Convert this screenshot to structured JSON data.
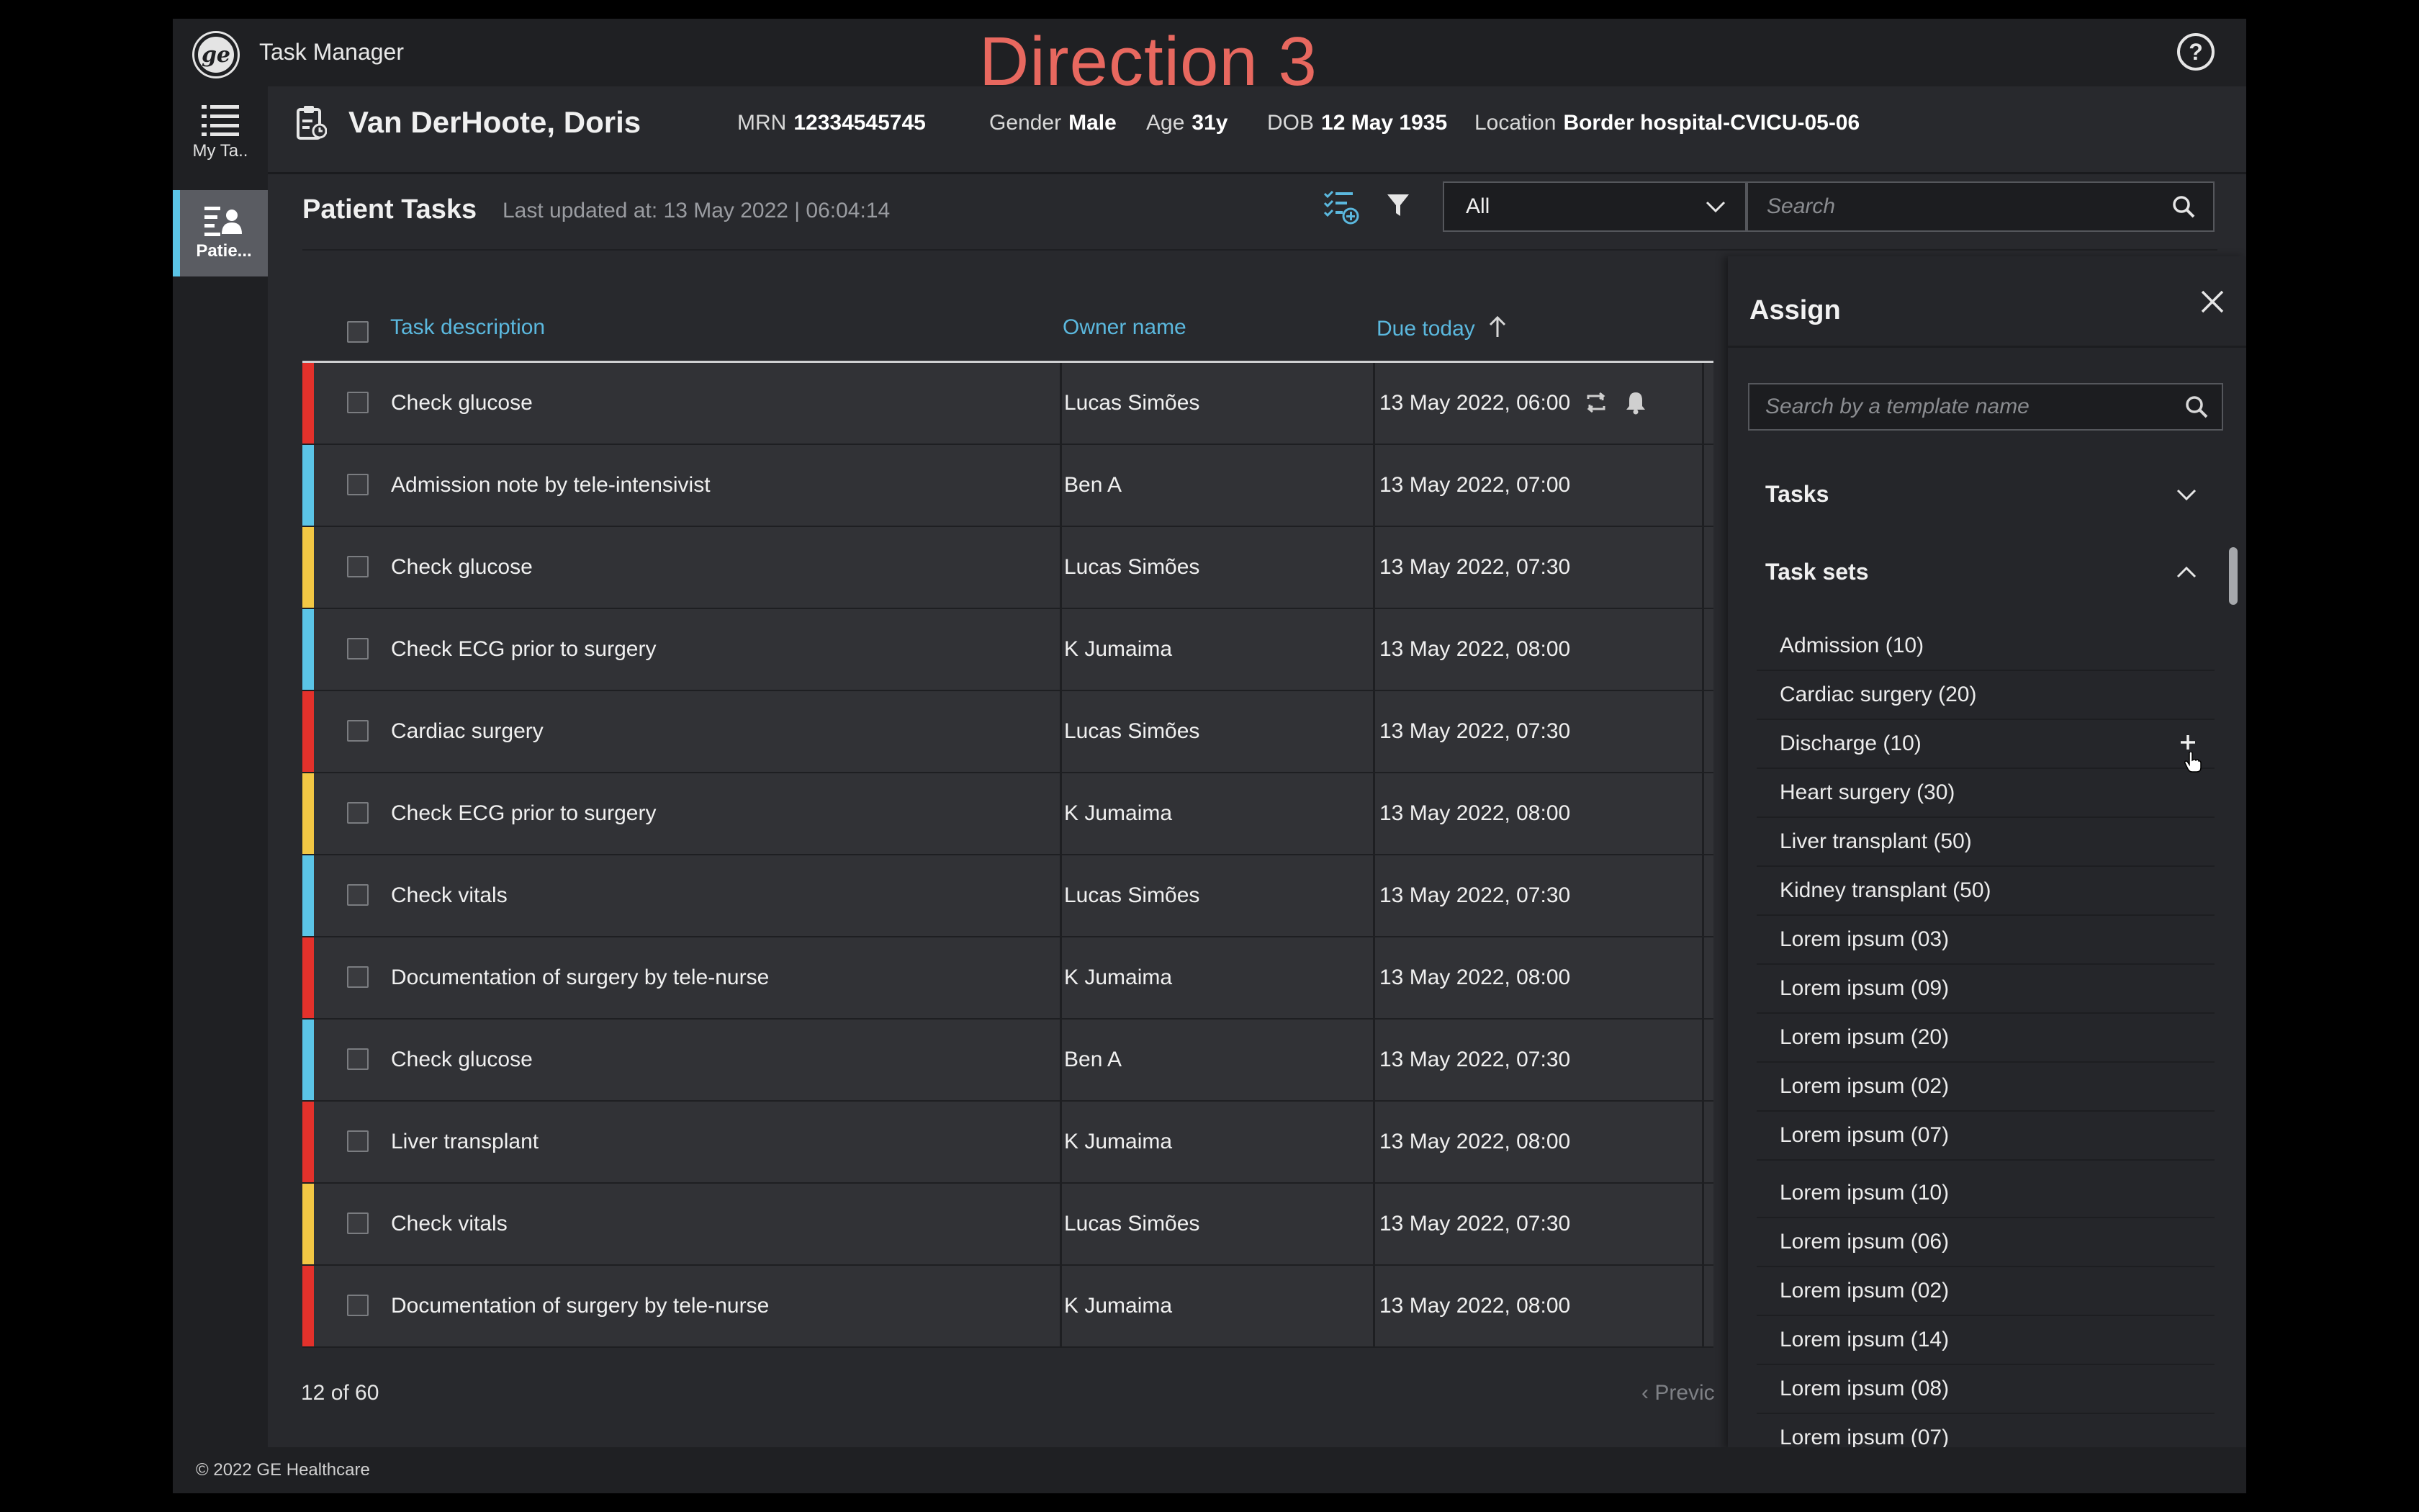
{
  "app": {
    "title": "Task Manager",
    "direction_label": "Direction 3",
    "help_glyph": "?"
  },
  "nav": {
    "items": [
      {
        "label": "My Ta..",
        "icon": "list-icon",
        "active": false
      },
      {
        "label": "Patie...",
        "icon": "patient-list-icon",
        "active": true
      }
    ],
    "accent": "#5bc4e6"
  },
  "patient": {
    "name": "Van DerHoote, Doris",
    "mrn_label": "MRN",
    "mrn": "12334545745",
    "gender_label": "Gender",
    "gender": "Male",
    "age_label": "Age",
    "age": "31y",
    "dob_label": "DOB",
    "dob": "12 May 1935",
    "location_label": "Location",
    "location": "Border hospital-CVICU-05-06"
  },
  "tasks_header": {
    "title": "Patient Tasks",
    "last_updated": "Last updated at: 13 May 2022 | 06:04:14",
    "filter_value": "All",
    "search_placeholder": "Search"
  },
  "table": {
    "columns": {
      "description": "Task description",
      "owner": "Owner name",
      "due": "Due today"
    },
    "sort": "ascending",
    "rows": [
      {
        "description": "Check glucose",
        "owner": "Lucas Simões",
        "due": "13 May 2022, 06:00",
        "priority_color": "#e3312b",
        "icons": [
          "recurring-icon",
          "bell-icon"
        ]
      },
      {
        "description": "Admission note by tele-intensivist",
        "owner": "Ben A",
        "due": "13 May 2022, 07:00",
        "priority_color": "#5bc4e6",
        "icons": []
      },
      {
        "description": "Check glucose",
        "owner": "Lucas Simões",
        "due": "13 May 2022, 07:30",
        "priority_color": "#f2c744",
        "icons": []
      },
      {
        "description": "Check ECG prior to surgery",
        "owner": "K Jumaima",
        "due": "13 May 2022, 08:00",
        "priority_color": "#5bc4e6",
        "icons": []
      },
      {
        "description": "Cardiac surgery",
        "owner": "Lucas Simões",
        "due": "13 May 2022, 07:30",
        "priority_color": "#e3312b",
        "icons": []
      },
      {
        "description": "Check ECG prior to surgery",
        "owner": "K Jumaima",
        "due": "13 May 2022, 08:00",
        "priority_color": "#f2c744",
        "icons": []
      },
      {
        "description": "Check vitals",
        "owner": "Lucas Simões",
        "due": "13 May 2022, 07:30",
        "priority_color": "#5bc4e6",
        "icons": []
      },
      {
        "description": "Documentation of surgery by tele-nurse",
        "owner": "K Jumaima",
        "due": "13 May 2022, 08:00",
        "priority_color": "#e3312b",
        "icons": []
      },
      {
        "description": "Check glucose",
        "owner": "Ben A",
        "due": "13 May 2022, 07:30",
        "priority_color": "#5bc4e6",
        "icons": []
      },
      {
        "description": "Liver transplant",
        "owner": "K Jumaima",
        "due": "13 May 2022, 08:00",
        "priority_color": "#e3312b",
        "icons": []
      },
      {
        "description": "Check vitals",
        "owner": "Lucas Simões",
        "due": "13 May 2022, 07:30",
        "priority_color": "#f2c744",
        "icons": []
      },
      {
        "description": "Documentation of surgery by tele-nurse",
        "owner": "K Jumaima",
        "due": "13 May 2022, 08:00",
        "priority_color": "#e3312b",
        "icons": []
      }
    ],
    "count": "12 of 60",
    "prev_label": "Previc"
  },
  "assign": {
    "title": "Assign",
    "search_placeholder": "Search by a template name",
    "tasks_label": "Tasks",
    "tasksets_label": "Task sets",
    "tasks_expanded": false,
    "tasksets_expanded": true,
    "task_sets": [
      "Admission (10)",
      "Cardiac surgery (20)",
      "Discharge (10)",
      "Heart surgery (30)",
      "Liver transplant (50)",
      "Kidney transplant (50)",
      "Lorem ipsum (03)",
      "Lorem ipsum (09)",
      "Lorem ipsum (20)",
      "Lorem ipsum (02)",
      "Lorem ipsum (07)",
      "Lorem ipsum (10)",
      "Lorem ipsum (06)",
      "Lorem ipsum (02)",
      "Lorem ipsum (14)",
      "Lorem ipsum (08)",
      "Lorem ipsum (07)"
    ],
    "hovered_item": "Discharge (10)"
  },
  "footer": {
    "copyright": "© 2022 GE Healthcare"
  }
}
